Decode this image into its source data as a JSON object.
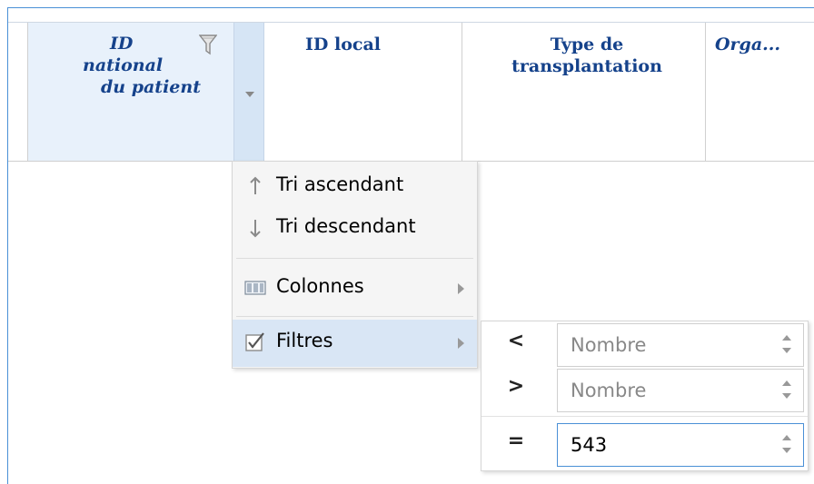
{
  "grid": {
    "columns": [
      {
        "id": "id_national",
        "label_lines": [
          "ID",
          "national",
          "du patient"
        ]
      },
      {
        "id": "id_local",
        "label": "ID local"
      },
      {
        "id": "type_transplantation",
        "label": "Type de transplantation"
      },
      {
        "id": "organe",
        "label": "Orga..."
      }
    ]
  },
  "menu": {
    "items": [
      {
        "icon": "arrow-up-icon",
        "label": "Tri ascendant"
      },
      {
        "icon": "arrow-down-icon",
        "label": "Tri descendant"
      },
      {
        "icon": "columns-icon",
        "label": "Colonnes",
        "has_submenu": true
      },
      {
        "icon": "checkbox-checked-icon",
        "label": "Filtres",
        "has_submenu": true,
        "active": true
      }
    ]
  },
  "filters": {
    "rows": [
      {
        "operator": "<",
        "placeholder": "Nombre",
        "value": ""
      },
      {
        "operator": ">",
        "placeholder": "Nombre",
        "value": ""
      },
      {
        "operator": "=",
        "placeholder": "Nombre",
        "value": "543"
      }
    ]
  },
  "colors": {
    "header_text": "#15428b",
    "active_header_bg": "#e8f1fb",
    "menu_active_bg": "#d9e6f5",
    "focus_border": "#4a90d6"
  }
}
